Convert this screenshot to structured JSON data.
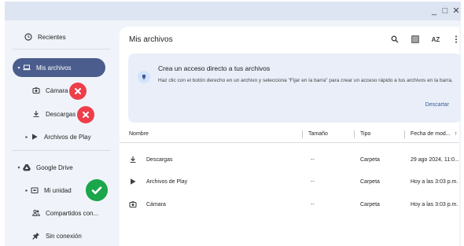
{
  "window": {
    "minimize_glyph": "_",
    "maximize_glyph": "□",
    "close_glyph": "✕"
  },
  "sidebar": {
    "recents": "Recientes",
    "my_files": "Mis archivos",
    "camera": "Cámara",
    "downloads": "Descargas",
    "play_files": "Archivos de Play",
    "google_drive": "Google Drive",
    "my_drive": "Mi unidad",
    "shared": "Compartidos con...",
    "offline": "Sin conexión"
  },
  "main": {
    "title": "Mis archivos",
    "sort_label": "AZ"
  },
  "banner": {
    "title": "Crea un acceso directo a tus archivos",
    "text": "Haz clic con el botón derecho en un archivo y selecciona \"Fijar en la barra\" para crear un acceso rápido a tus archivos en la barra.",
    "dismiss": "Descartar"
  },
  "table": {
    "columns": [
      "Nombre",
      "Tamaño",
      "Tipo",
      "Fecha de mod..."
    ],
    "sort_arrow": "↑",
    "rows": [
      {
        "name": "Descargas",
        "size": "--",
        "type": "Carpeta",
        "date": "29 ago 2024, 11:0...",
        "icon": "download-icon"
      },
      {
        "name": "Archivos de Play",
        "size": "--",
        "type": "Carpeta",
        "date": "Hoy a las 3:03 p.m.",
        "icon": "play-icon"
      },
      {
        "name": "Cámara",
        "size": "--",
        "type": "Carpeta",
        "date": "Hoy a las 3:03 p.m.",
        "icon": "camera-icon"
      }
    ]
  },
  "colors": {
    "active_pill": "#4b5d8c",
    "error_mark": "#ee3e4a",
    "success_mark": "#1aa64a",
    "link": "#3d5a94"
  }
}
